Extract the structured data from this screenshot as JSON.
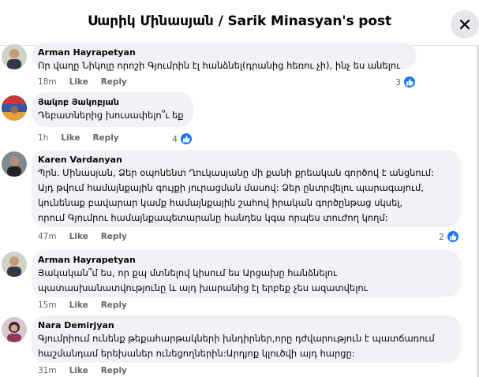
{
  "dialog": {
    "title": "Սարիկ Մինասյան / Sarik Minasyan's post",
    "close_icon": "close-icon"
  },
  "colors": {
    "like_blue": "#1877f2",
    "bubble_bg": "#f0f2f5",
    "meta_gray": "#65676b"
  },
  "comments": [
    {
      "author": "Arman Hayrapetyan",
      "text": "Որ վաղը Նիկոլը որոշի Գյումրին էլ հանձնել(դրանից հեռու չի), ինչ ես անելու",
      "time": "18m",
      "like": "Like",
      "reply": "Reply",
      "reactions": "3"
    },
    {
      "author": "Յակոբ Յակոբյան",
      "text": "Դեբատներից խուսափելո՞ւ եք",
      "time": "1h",
      "like": "Like",
      "reply": "Reply",
      "reactions": "4"
    },
    {
      "author": "Karen Vardanyan",
      "text": "Պրն. Մինասյան, Ձեր օպոնենտ Ղուկասյանը մի քանի քրեական գործով է անցնում:\nԱյդ թվում համայնքային գույքի յուրացման մասով: Ձեր ընտրվելու պարագայում,\nկունենաք բավարար կամք համայնքային շահով իրական գործընթաց սկսել,\nորում Գյումրու համայնքապետարանը հանդես կգա որպես տուժող կողմ:",
      "time": "47m",
      "like": "Like",
      "reply": "Reply",
      "reactions": "2"
    },
    {
      "author": "Arman Hayrapetyan",
      "text": "Յակական՞մ ես, որ քպ մտնելով կիսում ես Արցախը հանձնելու\nպատասխանատվությունը և այդ խարանից էլ երբեք չես ազատվելու",
      "time": "15m",
      "like": "Like",
      "reply": "Reply",
      "reactions": ""
    },
    {
      "author": "Nara Demirjyan",
      "text": "Գյումրիում ունենք թեքահարթակների խնդիրներ,որը դժվարություն է պատճառում\nհաշմանդամ երեխաներ ունեցողներին:Արդյոք կլուծվի այդ հարցը:",
      "time": "31m",
      "like": "Like",
      "reply": "Reply",
      "reactions": ""
    }
  ]
}
